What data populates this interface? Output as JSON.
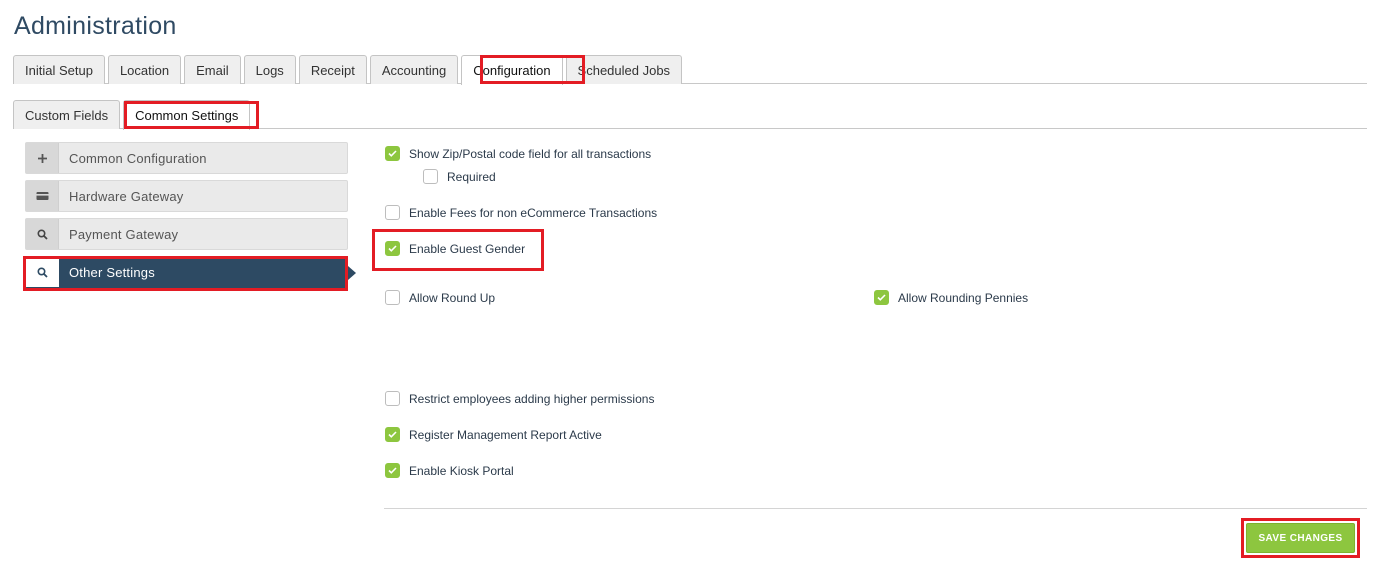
{
  "page": {
    "title": "Administration"
  },
  "top_tabs": [
    {
      "label": "Initial Setup"
    },
    {
      "label": "Location"
    },
    {
      "label": "Email"
    },
    {
      "label": "Logs"
    },
    {
      "label": "Receipt"
    },
    {
      "label": "Accounting"
    },
    {
      "label": "Configuration",
      "active": true
    },
    {
      "label": "Scheduled Jobs"
    }
  ],
  "sub_tabs": [
    {
      "label": "Custom Fields"
    },
    {
      "label": "Common Settings",
      "active": true
    }
  ],
  "side_nav": [
    {
      "label": "Common Configuration",
      "icon": "plus-icon"
    },
    {
      "label": "Hardware Gateway",
      "icon": "card-icon"
    },
    {
      "label": "Payment Gateway",
      "icon": "search-icon"
    },
    {
      "label": "Other Settings",
      "icon": "search-icon",
      "active": true
    }
  ],
  "options": {
    "show_zip": {
      "label": "Show Zip/Postal code field for all transactions",
      "checked": true
    },
    "zip_required": {
      "label": "Required",
      "checked": false
    },
    "enable_fees": {
      "label": "Enable Fees for non eCommerce Transactions",
      "checked": false
    },
    "guest_gender": {
      "label": "Enable Guest Gender",
      "checked": true
    },
    "round_up": {
      "label": "Allow Round Up",
      "checked": false
    },
    "rounding_pennies": {
      "label": "Allow Rounding Pennies",
      "checked": true
    },
    "restrict_permissions": {
      "label": "Restrict employees adding higher permissions",
      "checked": false
    },
    "register_report": {
      "label": "Register Management Report Active",
      "checked": true
    },
    "kiosk_portal": {
      "label": "Enable Kiosk Portal",
      "checked": true
    }
  },
  "actions": {
    "save_label": "SAVE CHANGES"
  },
  "colors": {
    "accent_green": "#8dc63f",
    "nav_active": "#2d4a63",
    "highlight_red": "#e31c24"
  }
}
